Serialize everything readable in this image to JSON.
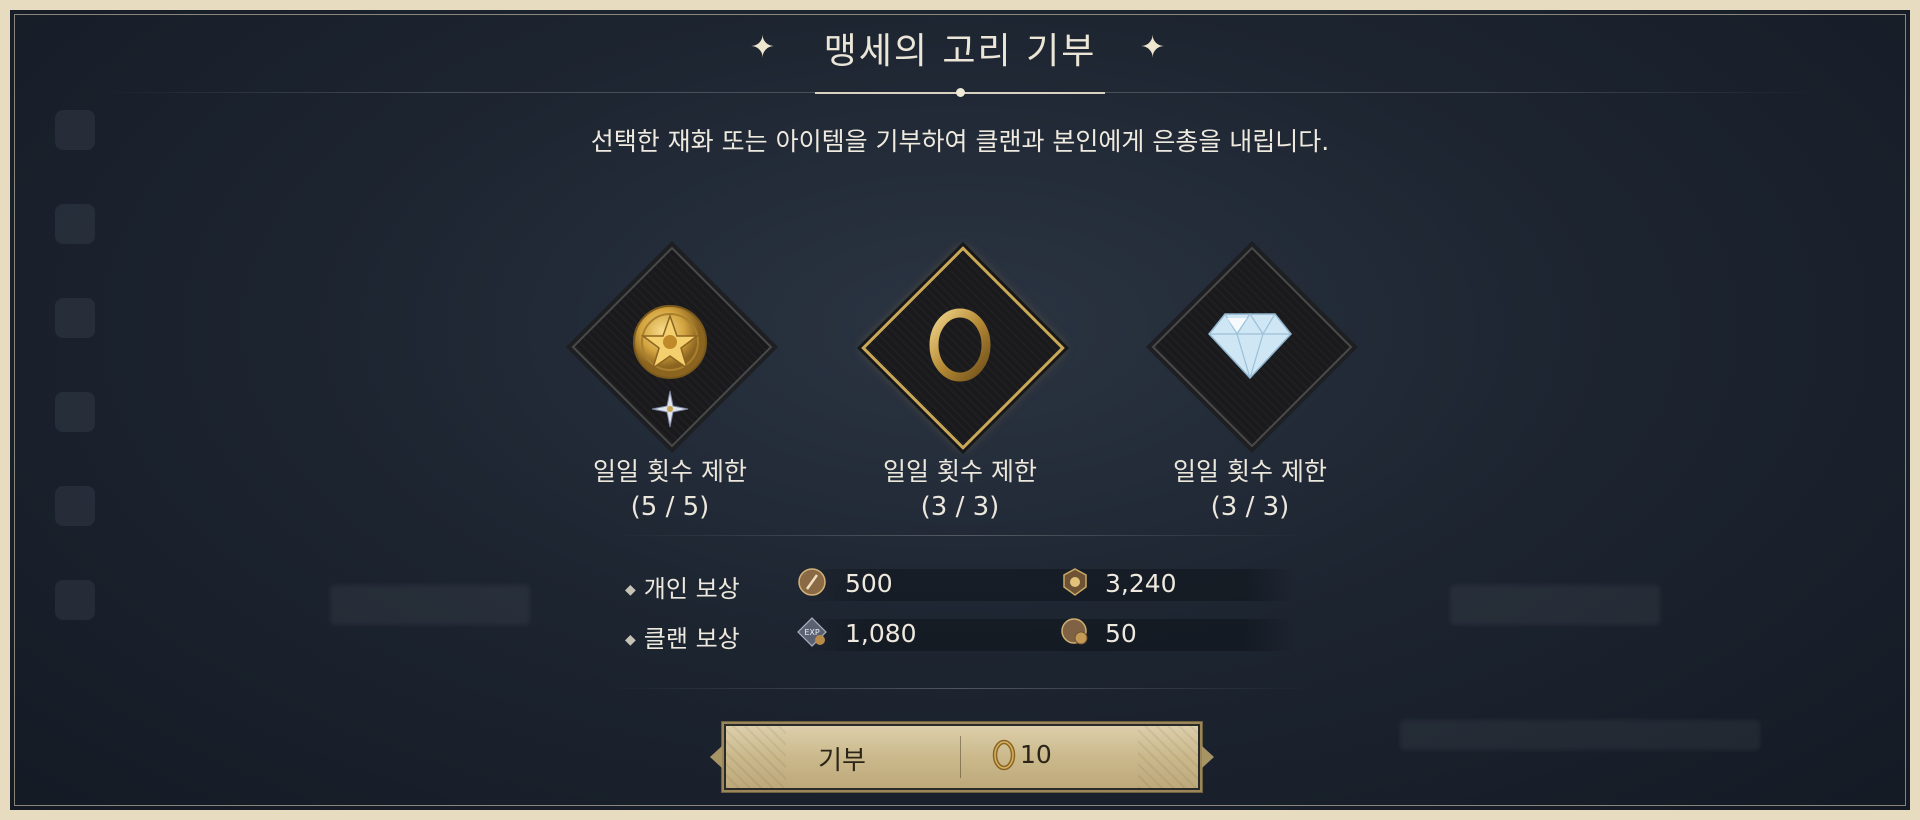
{
  "dialog": {
    "title": "맹세의 고리 기부",
    "description": "선택한 재화 또는 아이템을 기부하여 클랜과 본인에게 은총을 내립니다."
  },
  "items": [
    {
      "icon": "gold-star-medallion-icon",
      "label": "일일 횟수 제한",
      "count": "(5 / 5)",
      "selected": false
    },
    {
      "icon": "ring-icon",
      "label": "일일 횟수 제한",
      "count": "(3 / 3)",
      "selected": true
    },
    {
      "icon": "diamond-gem-icon",
      "label": "일일 횟수 제한",
      "count": "(3 / 3)",
      "selected": false
    }
  ],
  "rewards": {
    "personal": {
      "label": "개인 보상",
      "values": [
        {
          "icon": "feather-token-icon",
          "amount": "500"
        },
        {
          "icon": "medal-badge-icon",
          "amount": "3,240"
        }
      ]
    },
    "clan": {
      "label": "클랜 보상",
      "values": [
        {
          "icon": "exp-token-icon",
          "amount": "1,080"
        },
        {
          "icon": "coin-token-icon",
          "amount": "50"
        }
      ]
    }
  },
  "donate_button": {
    "label": "기부",
    "cost_icon": "ring-icon",
    "cost": "10"
  },
  "colors": {
    "frame": "#e7dcc0",
    "selected_border": "#c9a858",
    "button_gold": "#cbb98c"
  }
}
